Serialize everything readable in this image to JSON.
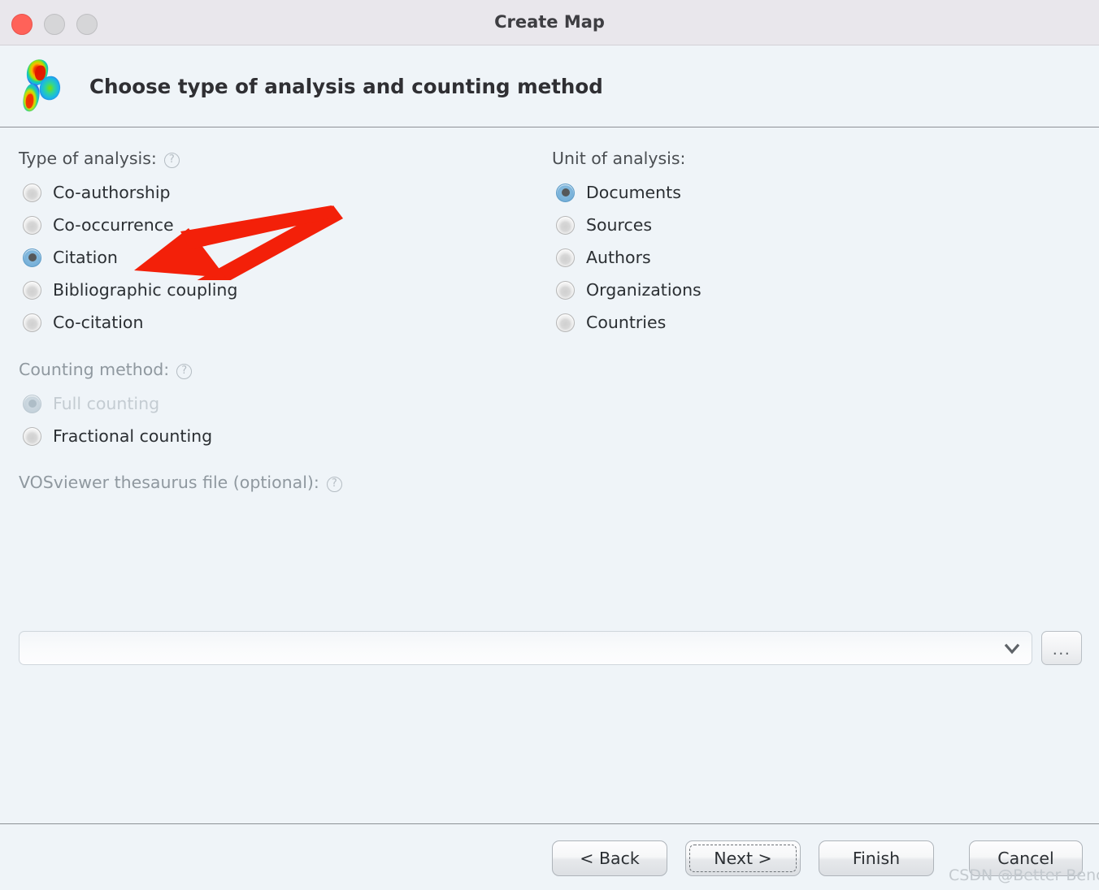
{
  "window": {
    "title": "Create Map",
    "traffic_lights": [
      "close",
      "minimize",
      "maximize"
    ]
  },
  "header": {
    "title": "Choose type of analysis and counting method",
    "logo_name": "vosviewer-density-logo"
  },
  "type_of_analysis": {
    "label": "Type of analysis:",
    "help_glyph": "?",
    "selected": "Citation",
    "options": [
      {
        "label": "Co-authorship",
        "selected": false,
        "disabled": false
      },
      {
        "label": "Co-occurrence",
        "selected": false,
        "disabled": false
      },
      {
        "label": "Citation",
        "selected": true,
        "disabled": false
      },
      {
        "label": "Bibliographic coupling",
        "selected": false,
        "disabled": false
      },
      {
        "label": "Co-citation",
        "selected": false,
        "disabled": false
      }
    ]
  },
  "unit_of_analysis": {
    "label": "Unit of analysis:",
    "selected": "Documents",
    "options": [
      {
        "label": "Documents",
        "selected": true,
        "disabled": false
      },
      {
        "label": "Sources",
        "selected": false,
        "disabled": false
      },
      {
        "label": "Authors",
        "selected": false,
        "disabled": false
      },
      {
        "label": "Organizations",
        "selected": false,
        "disabled": false
      },
      {
        "label": "Countries",
        "selected": false,
        "disabled": false
      }
    ]
  },
  "counting_method": {
    "label": "Counting method:",
    "help_glyph": "?",
    "disabled": true,
    "selected": "Full counting",
    "options": [
      {
        "label": "Full counting",
        "selected": true,
        "disabled": true
      },
      {
        "label": "Fractional counting",
        "selected": false,
        "disabled": false
      }
    ]
  },
  "thesaurus": {
    "label": "VOSviewer thesaurus file (optional):",
    "help_glyph": "?",
    "value": "",
    "placeholder": "",
    "dropdown_icon": "chevron-down-icon",
    "browse_label": "..."
  },
  "footer": {
    "buttons": [
      {
        "id": "back",
        "label": "< Back",
        "focused": false
      },
      {
        "id": "next",
        "label": "Next >",
        "focused": true
      },
      {
        "id": "finish",
        "label": "Finish",
        "focused": false
      },
      {
        "id": "cancel",
        "label": "Cancel",
        "focused": false
      }
    ]
  },
  "annotation": {
    "arrow_color": "#f32009",
    "points_to": "Citation"
  },
  "watermark": {
    "text": "CSDN @Better Bench"
  },
  "colors": {
    "window_bg": "#eff4f8",
    "titlebar_bg": "#e9e7ec",
    "accent_radio": "#6aa7d2",
    "close_button": "#ff6259",
    "annotation_red": "#f32009"
  }
}
